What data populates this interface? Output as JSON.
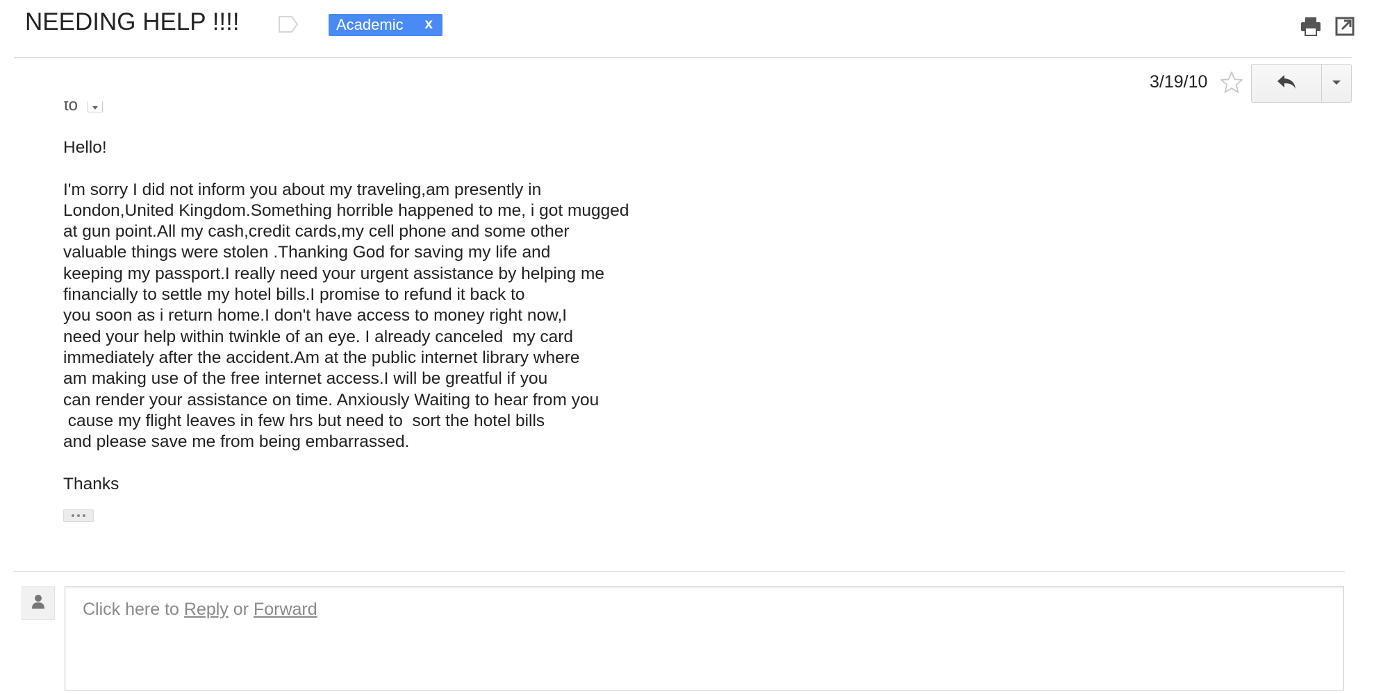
{
  "header": {
    "subject": "NEEDING HELP !!!!",
    "label": {
      "name": "Academic",
      "remove": "x",
      "color": "#4a8af4"
    },
    "icons": [
      "label-outline-icon",
      "print-icon",
      "open-in-new-window-icon"
    ]
  },
  "message": {
    "date": "3/19/10",
    "to_label": "to",
    "icons": [
      "star-icon",
      "reply-icon",
      "chevron-down-icon",
      "to-dropdown-icon",
      "trimmed-content-icon"
    ],
    "body": {
      "greeting": "Hello!",
      "paragraph_lines": [
        "I'm sorry I did not inform you about my traveling,am presently in",
        "London,United Kingdom.Something horrible happened to me, i got mugged",
        "at gun point.All my cash,credit cards,my cell phone and some other",
        "valuable things were stolen .Thanking God for saving my life and",
        "keeping my passport.I really need your urgent assistance by helping me",
        "financially to settle my hotel bills.I promise to refund it back to",
        "you soon as i return home.I don't have access to money right now,I",
        "need your help within twinkle of an eye. I already canceled  my card",
        "immediately after the accident.Am at the public internet library where",
        "am making use of the free internet access.I will be greatful if you",
        "can render your assistance on time. Anxiously Waiting to hear from you",
        " cause my flight leaves in few hrs but need to  sort the hotel bills",
        "and please save me from being embarrassed."
      ],
      "closing": "Thanks"
    }
  },
  "reply_area": {
    "prompt_prefix": "Click here to ",
    "reply_link": "Reply",
    "connector": " or ",
    "forward_link": "Forward",
    "icons": [
      "person-avatar-icon"
    ]
  }
}
